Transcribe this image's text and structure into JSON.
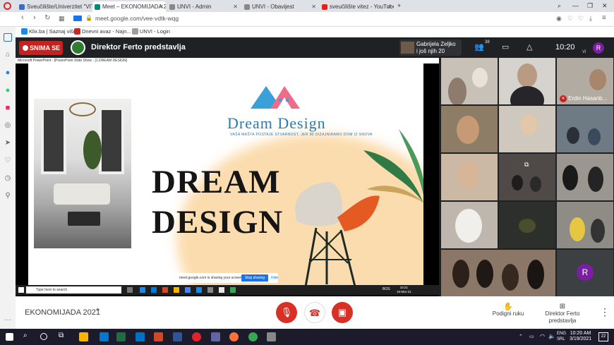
{
  "browser": {
    "tabs": [
      {
        "label": "Sveučilište/Univerzitet \"VIT",
        "color": "#3b6cc9",
        "active": false
      },
      {
        "label": "Meet – EKONOMIJADA 202",
        "color": "#00897b",
        "active": true
      },
      {
        "label": "UNVI - Admin",
        "color": "#888888",
        "active": false
      },
      {
        "label": "UNVI - Obavijest",
        "color": "#888888",
        "active": false
      },
      {
        "label": "sveučilište vitez - YouTube",
        "color": "#e62117",
        "active": false
      }
    ],
    "new_tab": "+",
    "url": "meet.google.com/vee-vdtk-wqg",
    "bookmarks": [
      {
        "label": "Klix.ba | Saznaj više",
        "color": "#1e88e5"
      },
      {
        "label": "Dnevni avaz - Najn...",
        "color": "#c62828"
      },
      {
        "label": "UNVI - Login",
        "color": "#9e9e9e"
      }
    ]
  },
  "meet": {
    "recording_label": "SNIMA SE",
    "presenter_label": "Direktor Ferto predstavlja",
    "participant_preview": {
      "name": "Gabrijela Zeljko",
      "extra": "i još njih 20"
    },
    "participant_count": "38",
    "time": "10:20",
    "self_initial": "R",
    "self_initial_label": "Vi",
    "meeting_name": "EKONOMIJADA 2021",
    "raise_hand_label": "Podigni ruku",
    "presenting_label": "Direktor Ferto predstavlja",
    "grid": {
      "tile_name": "Erdin Hasanb...",
      "avatar_initial": "R"
    }
  },
  "presentation": {
    "ppt_title": "Microsoft PowerPoint - [PowerPoint Slide Show - [1.DREAM DESIGN]",
    "brand": "Dream Design",
    "tagline": "VAŠA MAŠTA POSTAJE STVARNOST, JER MI DIZAJNIRAMO DOM IZ SNOVA",
    "title_line1": "DREAM",
    "title_line2": "DESIGN",
    "search_placeholder": "Type here to search",
    "share_notice": "meet.google.com is sharing your screen.",
    "stop_sharing": "Stop sharing",
    "hide": "Hide",
    "inner_time": "10:21",
    "inner_date": "19-Mar-21",
    "inner_lang": "BOS"
  },
  "windows": {
    "lang": "ENG",
    "lang2": "SRL",
    "time": "10:20 AM",
    "date": "3/19/2021",
    "notif_count": "22"
  }
}
